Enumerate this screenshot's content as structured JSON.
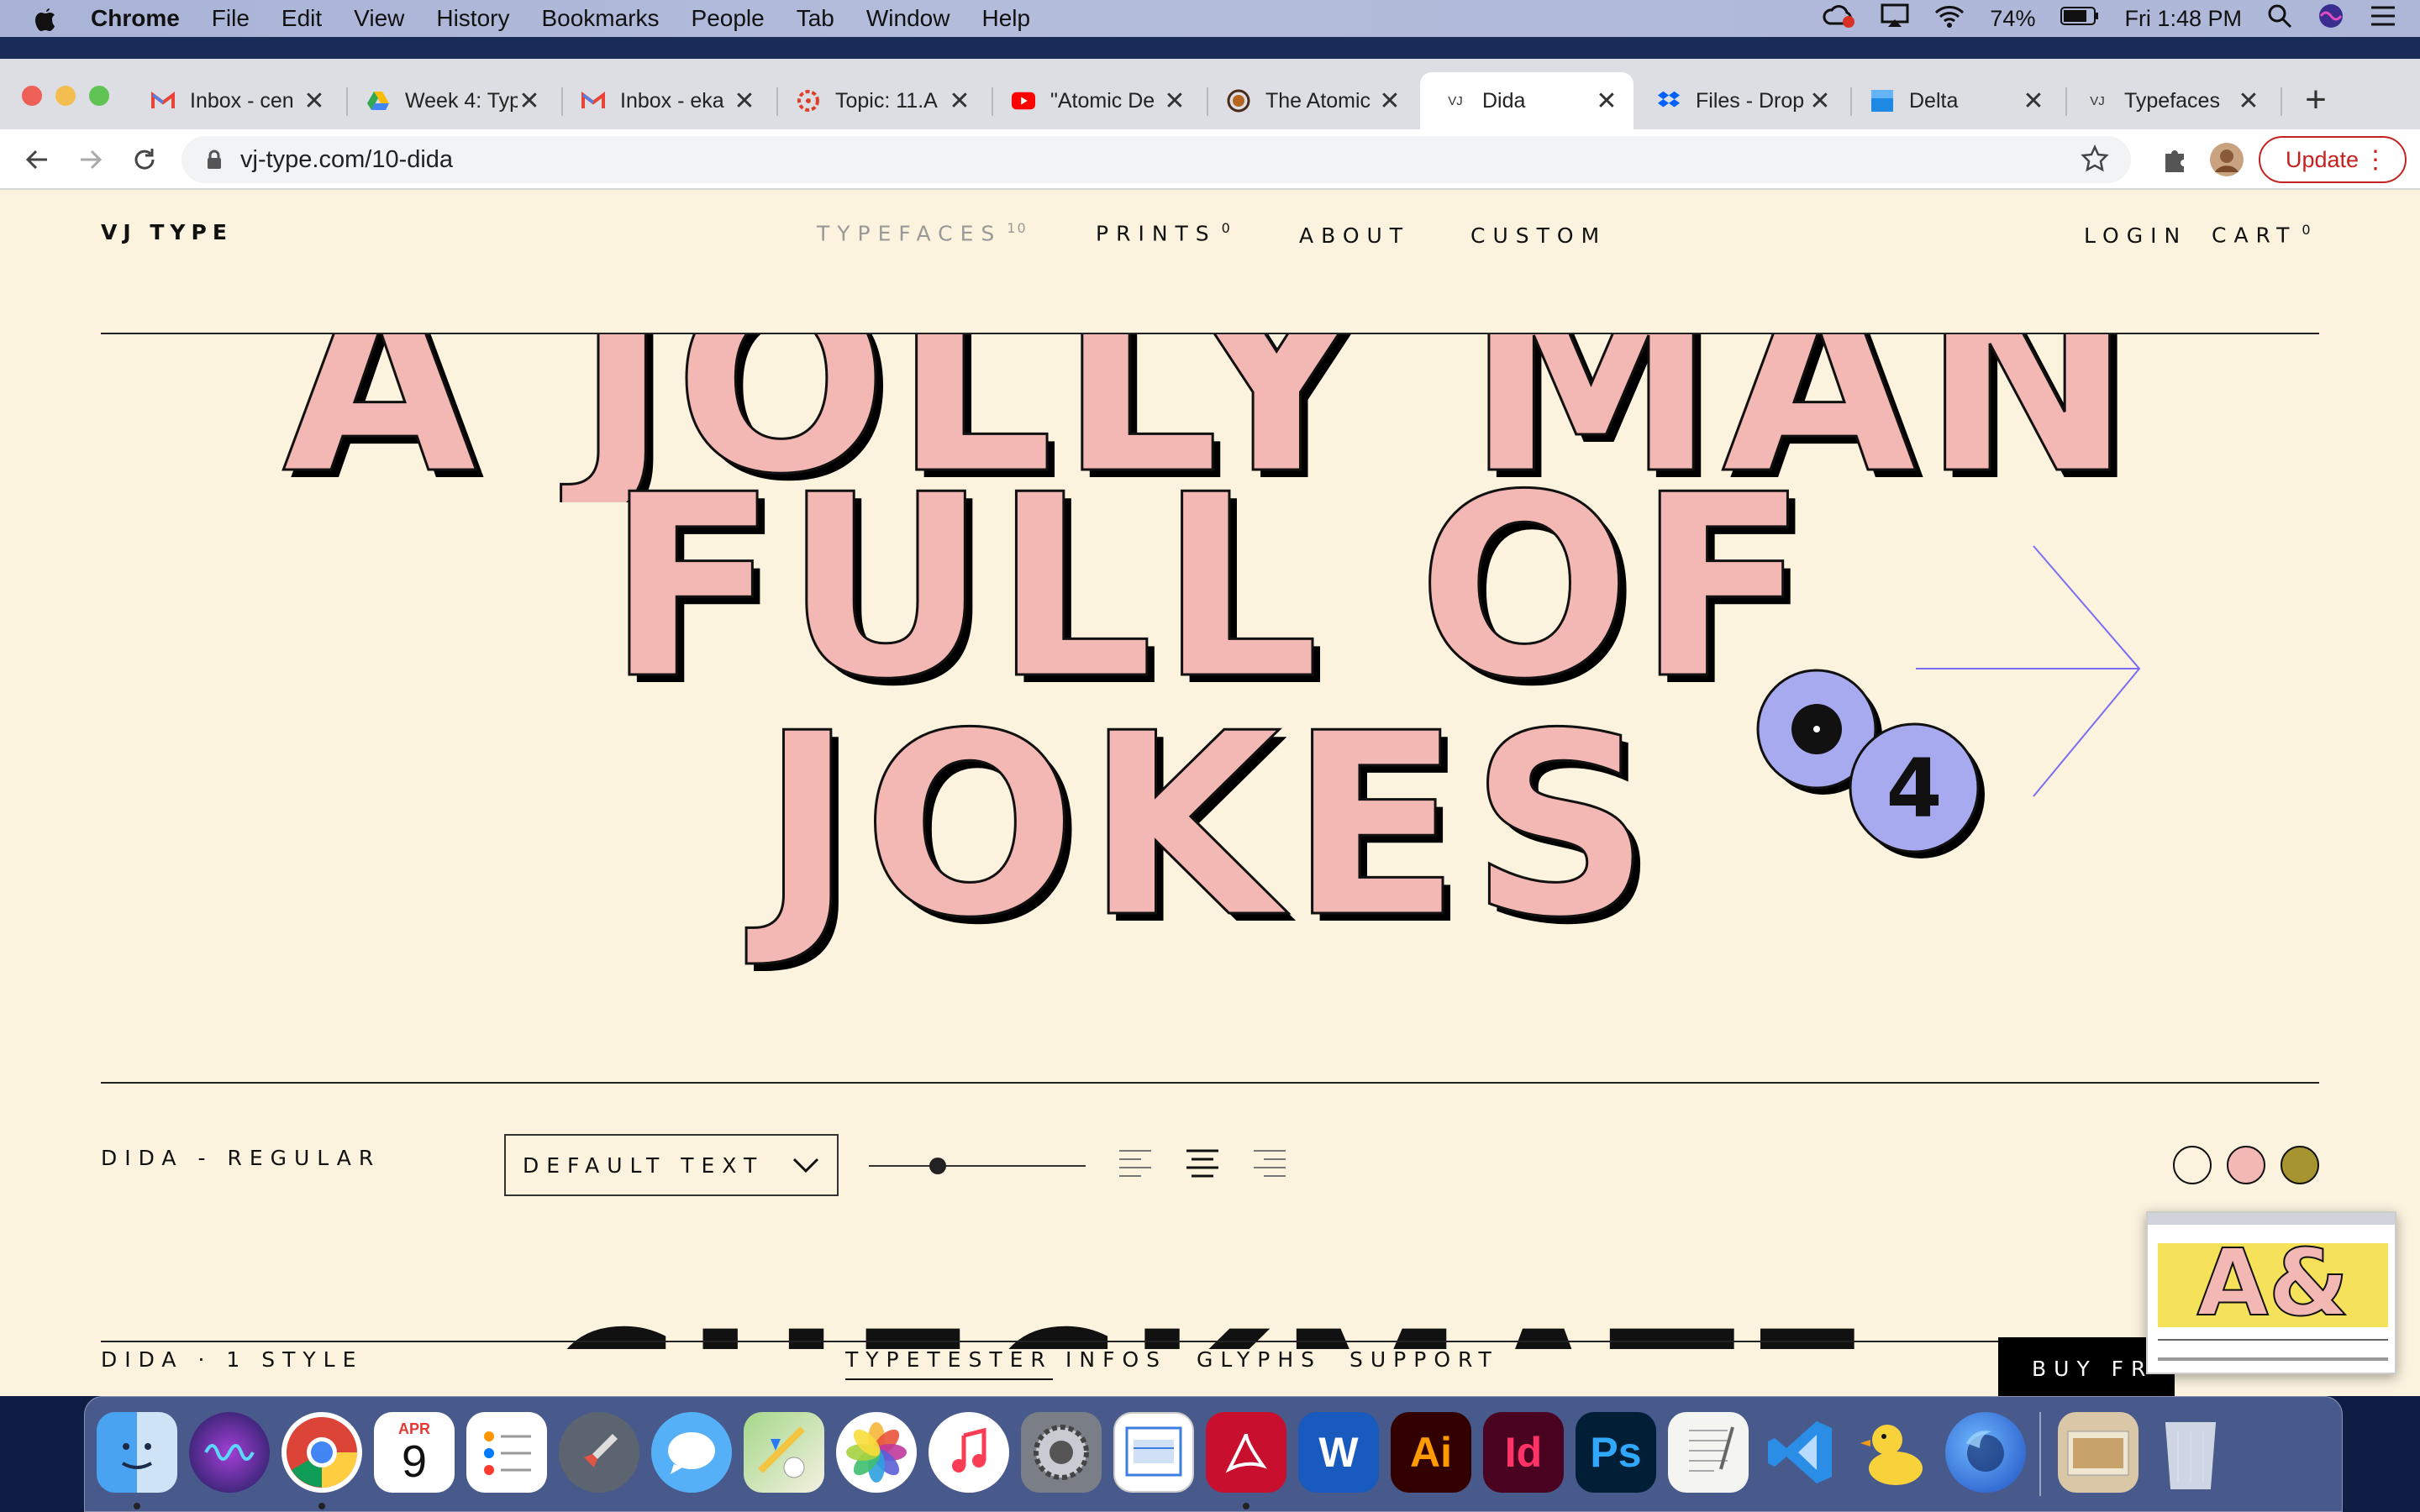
{
  "menubar": {
    "app_name": "Chrome",
    "items": [
      "File",
      "Edit",
      "View",
      "History",
      "Bookmarks",
      "People",
      "Tab",
      "Window",
      "Help"
    ],
    "battery": "74%",
    "clock": "Fri 1:48 PM"
  },
  "browser": {
    "tabs": [
      {
        "title": "Inbox - cen",
        "favicon": "gmail-icon"
      },
      {
        "title": "Week 4: Typ",
        "favicon": "google-drive-icon"
      },
      {
        "title": "Inbox - eka",
        "favicon": "gmail-icon"
      },
      {
        "title": "Topic: 11.A",
        "favicon": "canvas-icon"
      },
      {
        "title": "\"Atomic De",
        "favicon": "youtube-icon"
      },
      {
        "title": "The Atomic",
        "favicon": "record-icon"
      },
      {
        "title": "Dida",
        "favicon": "vj-icon",
        "active": true
      },
      {
        "title": "Files - Drop",
        "favicon": "dropbox-icon"
      },
      {
        "title": "Delta",
        "favicon": "blue-square-icon"
      },
      {
        "title": "Typefaces",
        "favicon": "vj-icon"
      }
    ],
    "favicon_text": "VJ",
    "url": "vj-type.com/10-dida",
    "update_label": "Update"
  },
  "site": {
    "logo": "VJ TYPE",
    "nav": {
      "typefaces": "TYPEFACES",
      "typefaces_count": "10",
      "prints": "PRINTS",
      "prints_count": "0",
      "about": "ABOUT",
      "custom": "CUSTOM",
      "login": "LOGIN",
      "cart": "CART",
      "cart_count": "0"
    },
    "hero_lines": [
      "A JOLLY MAN",
      "FULL OF",
      "JOKES"
    ],
    "footnote_number": "4",
    "style_label": "DIDA - REGULAR",
    "text_select_value": "DEFAULT TEXT",
    "swatch_colors": [
      "#fbf3de",
      "#f3b7b4",
      "#a69430"
    ],
    "accent_purple": "#a8aaf0",
    "next_line_text": "CHECKMATE",
    "bottom_nav": {
      "family_label": "DIDA · 1 STYLE",
      "tabs": [
        "TYPETESTER",
        "INFOS",
        "GLYPHS",
        "SUPPORT"
      ],
      "buy_label": "BUY FR"
    },
    "thumbnail_text": "A&"
  },
  "dock": {
    "apps": [
      "Finder",
      "Siri",
      "Chrome",
      "Calendar",
      "Reminders",
      "Launchpad",
      "Messages",
      "Maps",
      "Photos",
      "Music",
      "System Preferences",
      "Preview",
      "Acrobat",
      "Word",
      "Illustrator",
      "InDesign",
      "Photoshop",
      "TextEdit",
      "VS Code",
      "Cyberduck",
      "Firefox",
      "Downloads",
      "Trash"
    ],
    "calendar_month": "APR",
    "calendar_day": "9",
    "word_label": "W",
    "illustrator_label": "Ai",
    "indesign_label": "Id",
    "photoshop_label": "Ps"
  }
}
